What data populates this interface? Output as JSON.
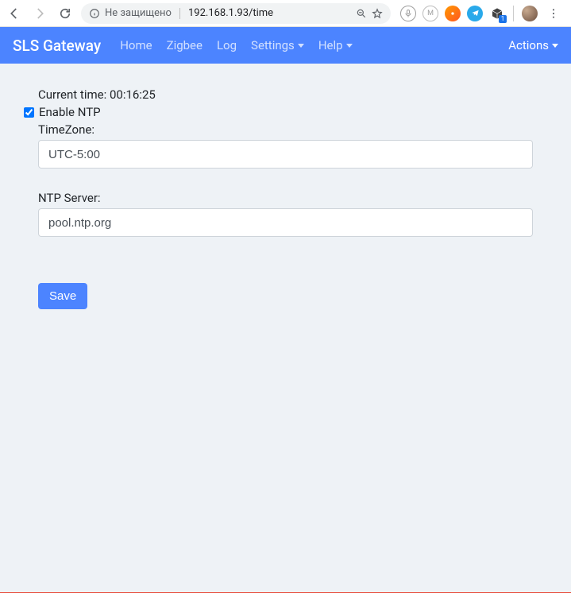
{
  "browser": {
    "security_text": "Не защищено",
    "url": "192.168.1.93/time",
    "ext_badge": "1"
  },
  "navbar": {
    "brand": "SLS Gateway",
    "links": {
      "home": "Home",
      "zigbee": "Zigbee",
      "log": "Log",
      "settings": "Settings",
      "help": "Help",
      "actions": "Actions"
    }
  },
  "form": {
    "current_time_label": "Current time: ",
    "current_time_value": "00:16:25",
    "enable_ntp_label": "Enable NTP",
    "enable_ntp_checked": true,
    "timezone_label": "TimeZone:",
    "timezone_value": "UTC-5:00",
    "ntpserver_label": "NTP Server:",
    "ntpserver_value": "pool.ntp.org",
    "save_label": "Save"
  }
}
